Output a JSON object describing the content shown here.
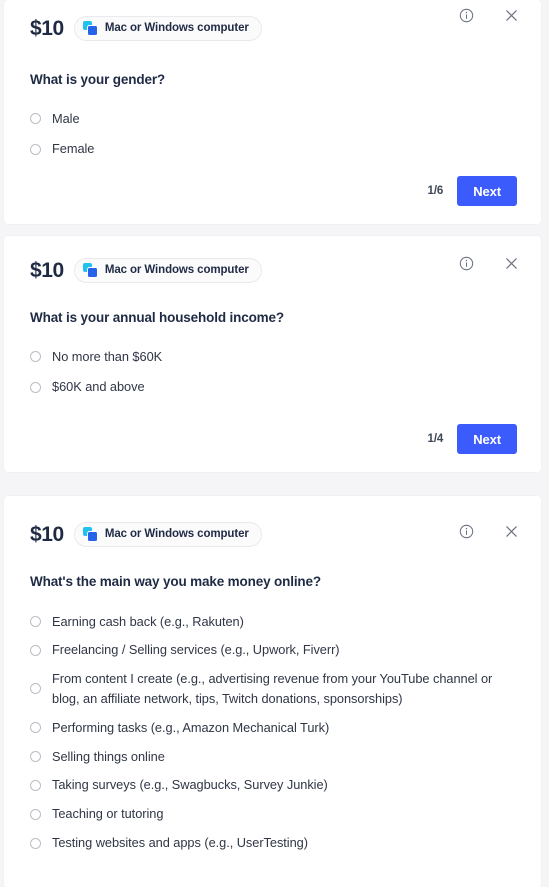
{
  "theme": {
    "accent": "#3b5bfd",
    "page_background": "#f5f5f7",
    "card_background": "#ffffff",
    "heading_color": "#1f2a44",
    "icon_cyan": "#22c2ee",
    "icon_blue": "#2563eb"
  },
  "cards": [
    {
      "price": "$10",
      "badge_label": "Mac or Windows computer",
      "badge_icon": "devices-icon",
      "info_icon": "info-circle-icon",
      "close_icon": "close-icon",
      "question": "What is your gender?",
      "options": [
        {
          "label": "Male"
        },
        {
          "label": "Female"
        }
      ],
      "counter": "1/6",
      "next_label": "Next"
    },
    {
      "price": "$10",
      "badge_label": "Mac or Windows computer",
      "badge_icon": "devices-icon",
      "info_icon": "info-circle-icon",
      "close_icon": "close-icon",
      "question": "What is your annual household income?",
      "options": [
        {
          "label": "No more than $60K"
        },
        {
          "label": "$60K and above"
        }
      ],
      "counter": "1/4",
      "next_label": "Next"
    },
    {
      "price": "$10",
      "badge_label": "Mac or Windows computer",
      "badge_icon": "devices-icon",
      "info_icon": "info-circle-icon",
      "close_icon": "close-icon",
      "question": "What's the main way you make money online?",
      "options": [
        {
          "label": "Earning cash back (e.g., Rakuten)"
        },
        {
          "label": "Freelancing / Selling services (e.g., Upwork, Fiverr)"
        },
        {
          "label": "From content I create (e.g., advertising revenue from your YouTube channel or blog, an affiliate network, tips, Twitch donations, sponsorships)"
        },
        {
          "label": "Performing tasks (e.g., Amazon Mechanical Turk)"
        },
        {
          "label": "Selling things online"
        },
        {
          "label": "Taking surveys (e.g., Swagbucks, Survey Junkie)"
        },
        {
          "label": "Teaching or tutoring"
        },
        {
          "label": "Testing websites and apps (e.g., UserTesting)"
        }
      ]
    }
  ]
}
